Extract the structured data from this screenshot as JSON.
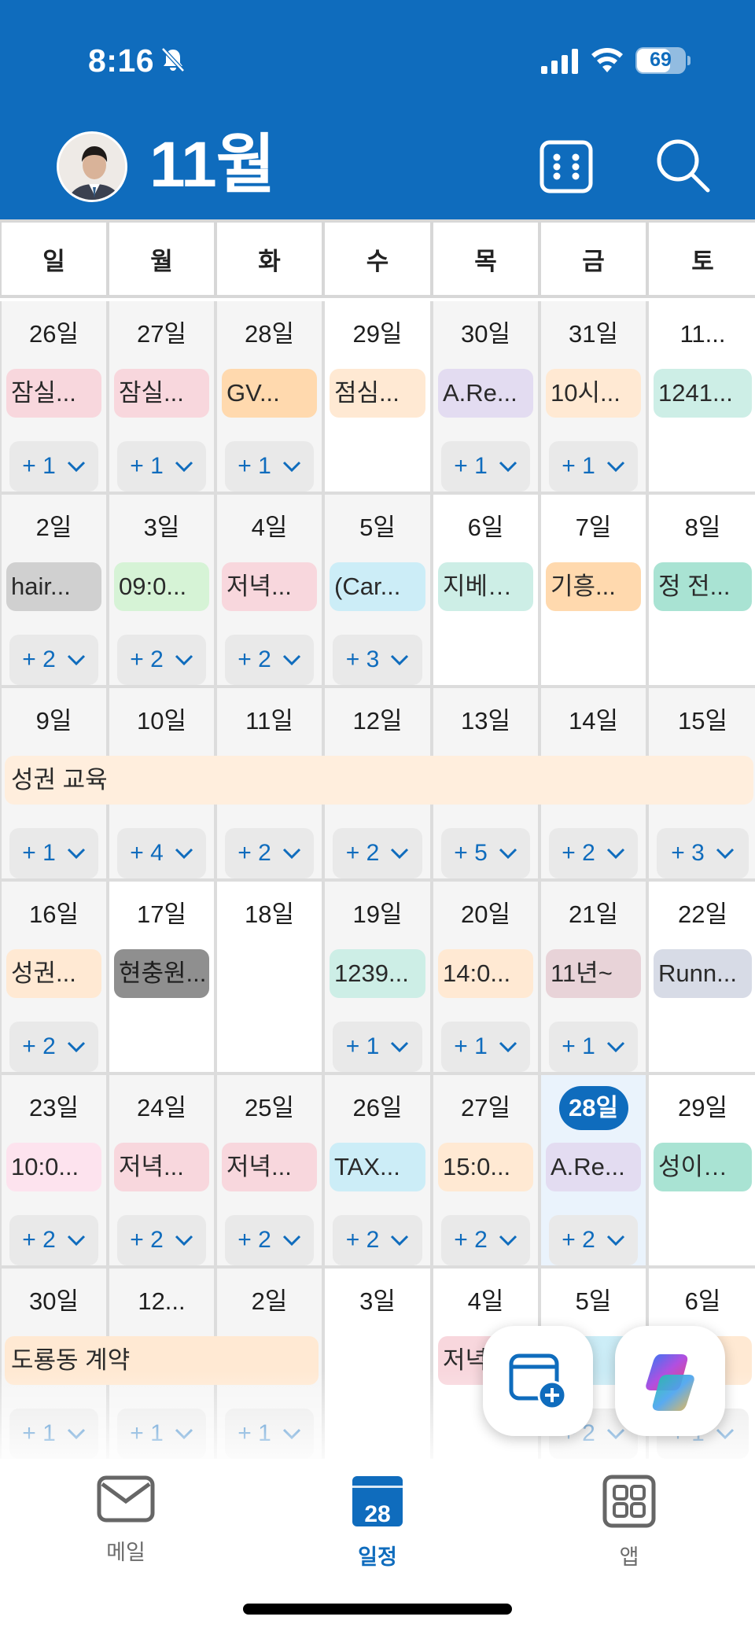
{
  "status_bar": {
    "time": "8:16",
    "battery": "69",
    "icons": [
      "bell-slash-icon",
      "cellular-signal-icon",
      "wifi-icon",
      "battery-icon"
    ]
  },
  "header": {
    "title": "11월",
    "buttons": [
      "view-switcher-grid-icon",
      "search-icon"
    ]
  },
  "weekdays": [
    "일",
    "월",
    "화",
    "수",
    "목",
    "금",
    "토"
  ],
  "weeks": [
    [
      {
        "day": "26일",
        "event": "잠실...",
        "color": "#f8d7dd",
        "more": "+ 1"
      },
      {
        "day": "27일",
        "event": "잠실...",
        "color": "#f8d7dd",
        "more": "+ 1"
      },
      {
        "day": "28일",
        "event": "GV...",
        "color": "#ffd9ae",
        "more": "+ 1"
      },
      {
        "day": "29일",
        "event": "점심...",
        "color": "#ffe9d3",
        "more": ""
      },
      {
        "day": "30일",
        "event": "A.Re...",
        "color": "#e3dcf1",
        "more": "+ 1"
      },
      {
        "day": "31일",
        "event": "10시...",
        "color": "#ffe9d3",
        "more": "+ 1"
      },
      {
        "day": "11...",
        "event": "1241...",
        "color": "#cdeee6",
        "more": ""
      }
    ],
    [
      {
        "day": "2일",
        "event": "hair...",
        "color": "#d0d0d0",
        "more": "+ 2"
      },
      {
        "day": "3일",
        "event": "09:0...",
        "color": "#d6f3d6",
        "more": "+ 2"
      },
      {
        "day": "4일",
        "event": "저녁...",
        "color": "#f8d7dd",
        "more": "+ 2"
      },
      {
        "day": "5일",
        "event": "(Car...",
        "color": "#ccedf7",
        "more": "+ 3"
      },
      {
        "day": "6일",
        "event": "지베…",
        "color": "#cdeee6",
        "more": ""
      },
      {
        "day": "7일",
        "event": "기흥...",
        "color": "#ffd9ae",
        "more": ""
      },
      {
        "day": "8일",
        "event": "정 전...",
        "color": "#a9e3d3",
        "more": ""
      }
    ],
    [
      {
        "day": "9일",
        "event": "",
        "color": "",
        "more": "+ 1"
      },
      {
        "day": "10일",
        "event": "",
        "color": "",
        "more": "+ 4"
      },
      {
        "day": "11일",
        "event": "",
        "color": "",
        "more": "+ 2"
      },
      {
        "day": "12일",
        "event": "",
        "color": "",
        "more": "+ 2"
      },
      {
        "day": "13일",
        "event": "",
        "color": "",
        "more": "+ 5"
      },
      {
        "day": "14일",
        "event": "",
        "color": "",
        "more": "+ 2"
      },
      {
        "day": "15일",
        "event": "",
        "color": "",
        "more": "+ 3"
      }
    ],
    [
      {
        "day": "16일",
        "event": "성권...",
        "color": "#ffe9d3",
        "more": "+ 2"
      },
      {
        "day": "17일",
        "event": "현충원...",
        "color": "#8f8f8f",
        "more": ""
      },
      {
        "day": "18일",
        "event": "",
        "color": "",
        "more": ""
      },
      {
        "day": "19일",
        "event": "1239...",
        "color": "#cdeee6",
        "more": "+ 1"
      },
      {
        "day": "20일",
        "event": "14:0...",
        "color": "#ffe9d3",
        "more": "+ 1"
      },
      {
        "day": "21일",
        "event": "11년~",
        "color": "#e8d3d8",
        "more": "+ 1"
      },
      {
        "day": "22일",
        "event": "Runn...",
        "color": "#d7dbe6",
        "more": ""
      }
    ],
    [
      {
        "day": "23일",
        "event": "10:0...",
        "color": "#fde3ee",
        "more": "+ 2"
      },
      {
        "day": "24일",
        "event": "저녁...",
        "color": "#f8d7dd",
        "more": "+ 2"
      },
      {
        "day": "25일",
        "event": "저녁...",
        "color": "#f8d7dd",
        "more": "+ 2"
      },
      {
        "day": "26일",
        "event": "TAX...",
        "color": "#ccedf7",
        "more": "+ 2"
      },
      {
        "day": "27일",
        "event": "15:0...",
        "color": "#ffe9d3",
        "more": "+ 2"
      },
      {
        "day": "28일",
        "event": "A.Re...",
        "color": "#e3dcf1",
        "more": "+ 2"
      },
      {
        "day": "29일",
        "event": "성이…",
        "color": "#a9e3d3",
        "more": ""
      }
    ],
    [
      {
        "day": "30일",
        "event": "",
        "color": "",
        "more": "+ 1"
      },
      {
        "day": "12...",
        "event": "",
        "color": "",
        "more": "+ 1"
      },
      {
        "day": "2일",
        "event": "",
        "color": "",
        "more": "+ 1"
      },
      {
        "day": "3일",
        "event": "",
        "color": "",
        "more": ""
      },
      {
        "day": "4일",
        "event": "저녁",
        "color": "#f8d7dd",
        "more": ""
      },
      {
        "day": "5일",
        "event": "r...",
        "color": "#ccedf7",
        "more": "+ 2"
      },
      {
        "day": "6일",
        "event": "...",
        "color": "#ffe9d3",
        "more": "+ 1"
      }
    ]
  ],
  "spanning_events": [
    {
      "label": "성권 교육",
      "color": "#ffeedd"
    },
    {
      "label": "도룡동 계약",
      "color": "#ffe9d3"
    }
  ],
  "today": "28일",
  "fabs": [
    "new-event-icon",
    "copilot-icon"
  ],
  "tabs": [
    {
      "label": "메일",
      "icon": "mail-icon"
    },
    {
      "label": "일정",
      "icon": "calendar-icon",
      "badge": "28"
    },
    {
      "label": "앱",
      "icon": "apps-icon"
    }
  ],
  "active_tab": "일정",
  "colors": {
    "brand": "#0f6cbd",
    "today_background": "#eaf3fc"
  }
}
